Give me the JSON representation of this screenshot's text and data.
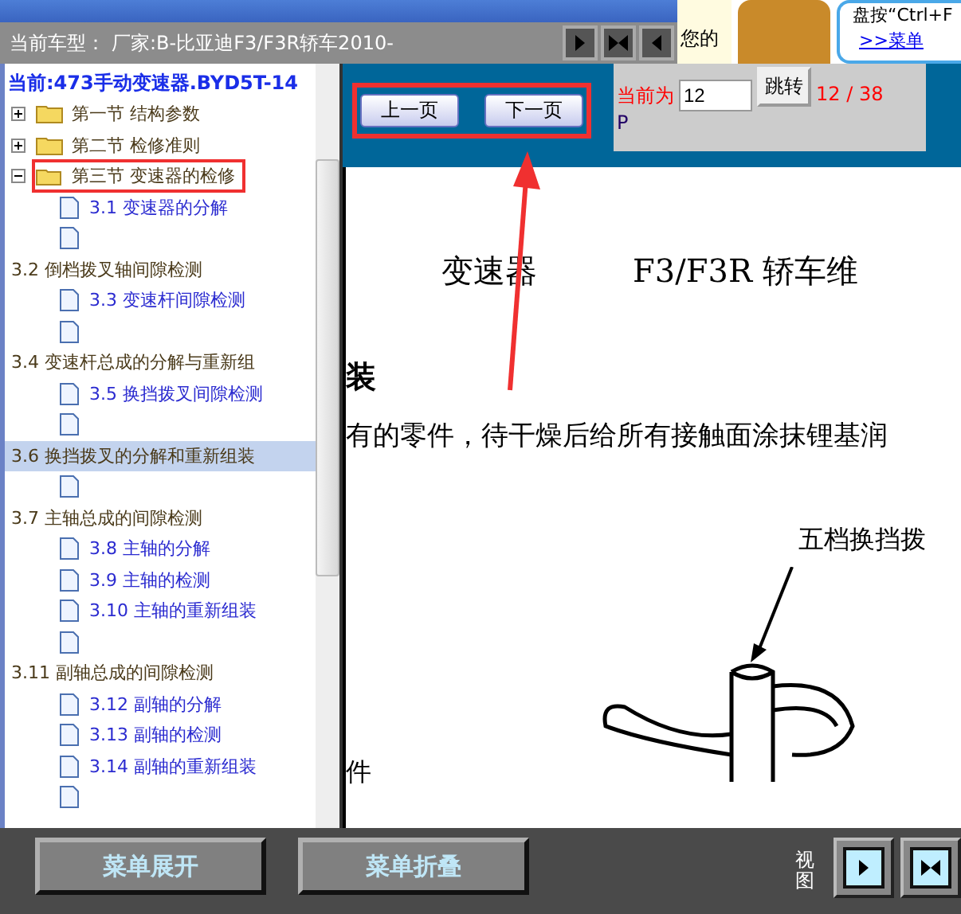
{
  "top_bar": {
    "car_label": "当前车型：",
    "car_value": "厂家:B-比亚迪F3/F3R轿车2010-",
    "notice": "您的",
    "hint": "盘按“Ctrl+F",
    "hint_link": ">>菜单"
  },
  "tree": {
    "title": "当前:473手动变速器.BYD5T-14",
    "items": [
      {
        "kind": "folder",
        "label": "第一节 结构参数",
        "expanded": false,
        "marked": false
      },
      {
        "kind": "folder",
        "label": "第二节 检修准则",
        "expanded": false,
        "marked": false
      },
      {
        "kind": "folder",
        "label": "第三节 变速器的检修",
        "expanded": true,
        "marked": true,
        "children": [
          {
            "kind": "page",
            "label": "3.1 变速器的分解",
            "selected": false
          },
          {
            "kind": "page",
            "selected": false
          },
          {
            "kind": "text",
            "label": "3.2 倒档拨叉轴间隙检测",
            "selected": false
          },
          {
            "kind": "page",
            "label": "3.3 变速杆间隙检测",
            "selected": false
          },
          {
            "kind": "page",
            "selected": false
          },
          {
            "kind": "text",
            "label": "3.4 变速杆总成的分解与重新组",
            "selected": false
          },
          {
            "kind": "page",
            "label": "3.5 换挡拨叉间隙检测",
            "selected": false
          },
          {
            "kind": "page",
            "selected": false
          },
          {
            "kind": "text",
            "label": "3.6 换挡拨叉的分解和重新组装",
            "selected": true
          },
          {
            "kind": "page",
            "selected": false
          },
          {
            "kind": "text",
            "label": "3.7 主轴总成的间隙检测",
            "selected": false
          },
          {
            "kind": "page",
            "label": "3.8 主轴的分解",
            "selected": false
          },
          {
            "kind": "page",
            "label": "3.9 主轴的检测",
            "selected": false
          },
          {
            "kind": "page",
            "label": "3.10 主轴的重新组装",
            "selected": false
          },
          {
            "kind": "page",
            "selected": false
          },
          {
            "kind": "text",
            "label": "3.11 副轴总成的间隙检测",
            "selected": false
          },
          {
            "kind": "page",
            "label": "3.12 副轴的分解",
            "selected": false
          },
          {
            "kind": "page",
            "label": "3.13 副轴的检测",
            "selected": false
          },
          {
            "kind": "page",
            "label": "3.14 副轴的重新组装",
            "selected": false
          },
          {
            "kind": "page",
            "selected": false
          }
        ]
      }
    ]
  },
  "pager": {
    "prev": "上一页",
    "next": "下一页",
    "current_label": "当前为",
    "page_value": "12",
    "go": "跳转",
    "count": "12 / 38",
    "unit": "P"
  },
  "document": {
    "title_left": "变速器",
    "title_right": "F3/F3R 轿车维",
    "heading": "装",
    "paragraph": "有的零件，待干燥后给所有接触面涂抹锂基润",
    "figure_label": "五档换挡拨",
    "footer_text": "件"
  },
  "bottom_bar": {
    "buttons": [
      "菜单展开",
      "菜单折叠"
    ],
    "view_label": "视图"
  }
}
